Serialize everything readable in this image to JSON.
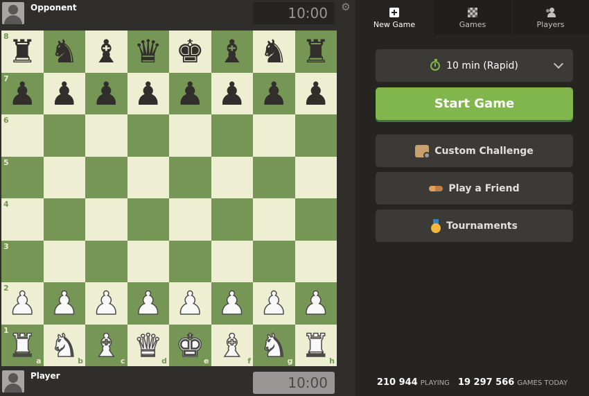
{
  "opponent": {
    "name": "Opponent",
    "clock": "10:00"
  },
  "player": {
    "name": "Player",
    "clock": "10:00"
  },
  "board": {
    "ranks": [
      "8",
      "7",
      "6",
      "5",
      "4",
      "3",
      "2",
      "1"
    ],
    "files": [
      "a",
      "b",
      "c",
      "d",
      "e",
      "f",
      "g",
      "h"
    ],
    "position": [
      [
        "bR",
        "bN",
        "bB",
        "bQ",
        "bK",
        "bB",
        "bN",
        "bR"
      ],
      [
        "bP",
        "bP",
        "bP",
        "bP",
        "bP",
        "bP",
        "bP",
        "bP"
      ],
      [
        "",
        "",
        "",
        "",
        "",
        "",
        "",
        ""
      ],
      [
        "",
        "",
        "",
        "",
        "",
        "",
        "",
        ""
      ],
      [
        "",
        "",
        "",
        "",
        "",
        "",
        "",
        ""
      ],
      [
        "",
        "",
        "",
        "",
        "",
        "",
        "",
        ""
      ],
      [
        "wP",
        "wP",
        "wP",
        "wP",
        "wP",
        "wP",
        "wP",
        "wP"
      ],
      [
        "wR",
        "wN",
        "wB",
        "wQ",
        "wK",
        "wB",
        "wN",
        "wR"
      ]
    ],
    "light_color": "#eeeed2",
    "dark_color": "#769656"
  },
  "tabs": [
    {
      "label": "New Game",
      "icon": "plus-square-icon",
      "active": true
    },
    {
      "label": "Games",
      "icon": "checkerboard-icon",
      "active": false
    },
    {
      "label": "Players",
      "icon": "players-icon",
      "active": false
    }
  ],
  "time_control": {
    "label": "10 min (Rapid)",
    "icon": "stopwatch-icon"
  },
  "buttons": {
    "start": "Start Game",
    "custom": "Custom Challenge",
    "friend": "Play a Friend",
    "tournaments": "Tournaments"
  },
  "stats": {
    "playing_count": "210 944",
    "playing_label": "PLAYING",
    "games_count": "19 297 566",
    "games_label": "GAMES TODAY"
  },
  "colors": {
    "accent": "#81b64c",
    "panel": "#262421",
    "button": "#3c3a37"
  }
}
